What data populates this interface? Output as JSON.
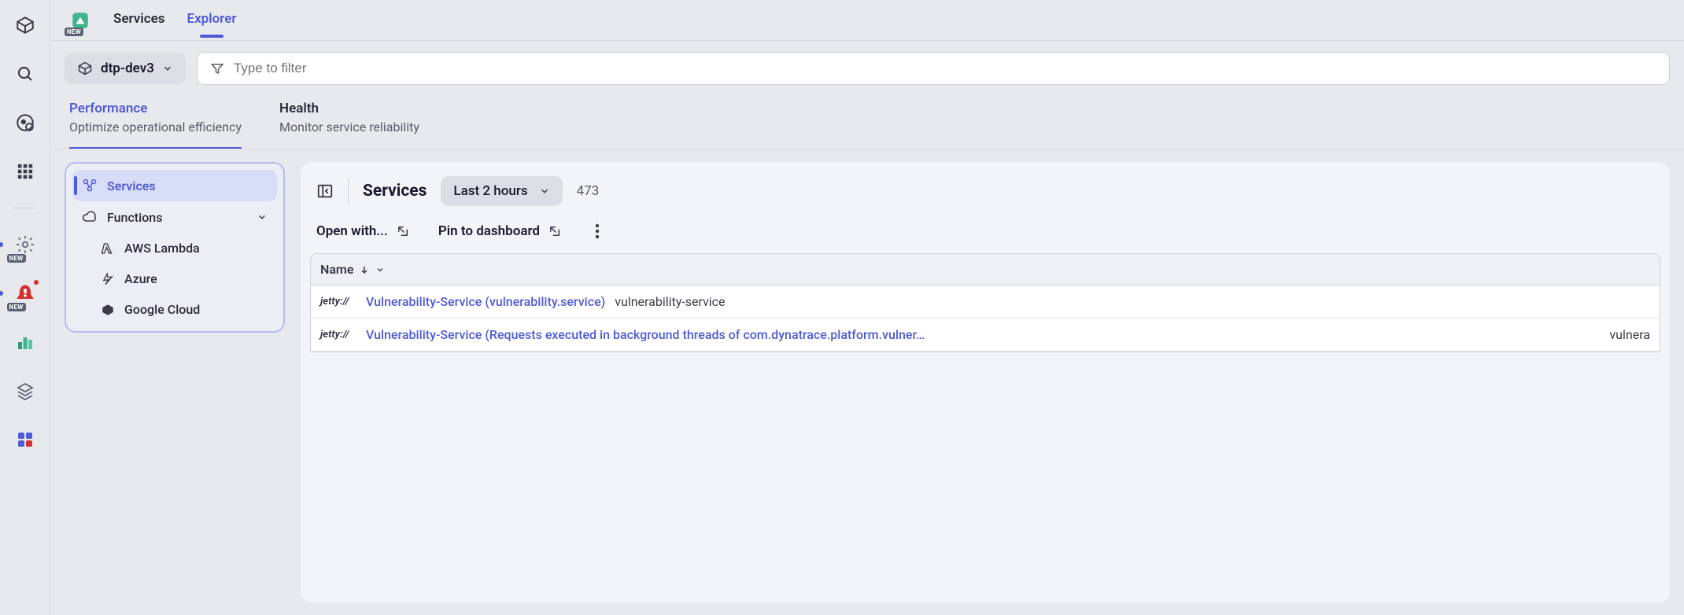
{
  "rail": {
    "new_badge": "NEW"
  },
  "topbar": {
    "tabs": [
      {
        "label": "Services"
      },
      {
        "label": "Explorer"
      }
    ]
  },
  "filterbar": {
    "env_label": "dtp-dev3",
    "filter_placeholder": "Type to filter"
  },
  "segments": [
    {
      "title": "Performance",
      "subtitle": "Optimize operational efficiency"
    },
    {
      "title": "Health",
      "subtitle": "Monitor service reliability"
    }
  ],
  "tree": {
    "services": "Services",
    "functions": "Functions",
    "aws_lambda": "AWS Lambda",
    "azure": "Azure",
    "google_cloud": "Google Cloud"
  },
  "panel": {
    "title": "Services",
    "time_range": "Last 2 hours",
    "count": "473",
    "open_with": "Open with...",
    "pin": "Pin to dashboard",
    "col_name": "Name"
  },
  "rows": [
    {
      "tech": "jetty://",
      "name": "Vulnerability-Service (vulnerability.service)",
      "meta": "vulnerability-service"
    },
    {
      "tech": "jetty://",
      "name": "Vulnerability-Service (Requests executed in background threads of com.dynatrace.platform.vulner…",
      "meta": "vulnera"
    }
  ]
}
